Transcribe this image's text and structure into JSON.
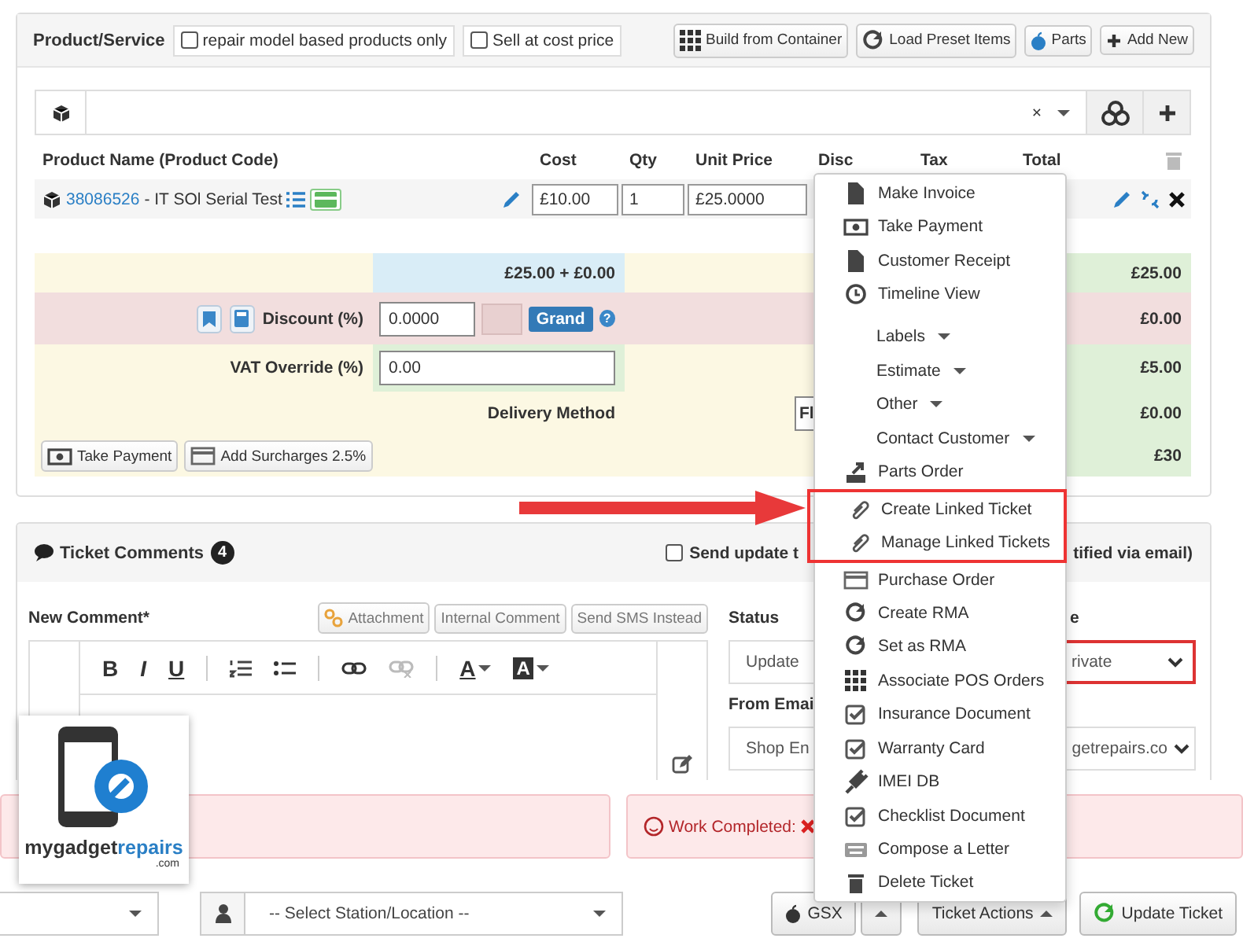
{
  "product_panel": {
    "title": "Product/Service",
    "options": [
      {
        "label": "repair model based products only",
        "checked": false
      },
      {
        "label": "Sell at cost price",
        "checked": false
      }
    ],
    "actions": [
      "Build from Container",
      "Load Preset Items",
      "Parts",
      "Add New"
    ]
  },
  "search": {
    "clear": "×"
  },
  "table": {
    "columns": [
      "Product Name (Product Code)",
      "Cost",
      "Qty",
      "Unit Price",
      "Disc",
      "Tax",
      "Total"
    ],
    "rows": [
      {
        "code": "38086526",
        "name": " - IT SOl Serial Test",
        "cost": "£10.00",
        "qty": "1",
        "unit_price": "£25.0000"
      }
    ]
  },
  "totals": {
    "subtotal": "£25.00 + £0.00",
    "discount_label": "Discount (%)",
    "discount": "0.0000",
    "discount_mode": "Grand",
    "help": "?",
    "vat_label": "VAT Override (%)",
    "vat": "0.00",
    "delivery_label": "Delivery Method",
    "delivery": "Fl",
    "buttons": [
      "Take Payment",
      "Add Surcharges 2.5%"
    ],
    "amounts": [
      "£25.00",
      "£0.00",
      "£5.00",
      "£0.00",
      "£30"
    ]
  },
  "comments": {
    "title": "Ticket Comments",
    "count": "4",
    "notify_start": "Send update t",
    "notify_end": "tified via email)",
    "notify_checked": false,
    "new_comment_label": "New Comment*",
    "buttons": [
      "Attachment",
      "Internal Comment",
      "Send SMS Instead"
    ],
    "toolbar": [
      "B",
      "I",
      "U",
      "A",
      "A"
    ],
    "status_label": "Status",
    "status": "Update",
    "type_label": "e",
    "type": "rivate",
    "from_label": "From Emai",
    "from_start": "Shop En",
    "from_end": "getrepairs.co"
  },
  "alert": {
    "text": "Work Completed:"
  },
  "footer": {
    "station_placeholder": "-- Select Station/Location --",
    "gsx": "GSX",
    "ticket_actions": "Ticket Actions",
    "update": "Update Ticket"
  },
  "menu": {
    "items": [
      {
        "label": "Make Invoice",
        "kind": "action",
        "highlighted": false
      },
      {
        "label": "Take Payment",
        "kind": "action",
        "highlighted": false
      },
      {
        "label": "Customer Receipt",
        "kind": "action",
        "highlighted": false
      },
      {
        "label": "Timeline View",
        "kind": "action",
        "highlighted": false
      },
      {
        "label": "Labels",
        "kind": "submenu",
        "highlighted": false
      },
      {
        "label": "Estimate",
        "kind": "submenu",
        "highlighted": false
      },
      {
        "label": "Other",
        "kind": "submenu",
        "highlighted": false
      },
      {
        "label": "Contact Customer",
        "kind": "submenu",
        "highlighted": false
      },
      {
        "label": "Parts Order",
        "kind": "action",
        "highlighted": false
      },
      {
        "label": "Create Linked Ticket",
        "kind": "action",
        "highlighted": true
      },
      {
        "label": "Manage Linked Tickets",
        "kind": "action",
        "highlighted": true
      },
      {
        "label": "Purchase Order",
        "kind": "action",
        "highlighted": false
      },
      {
        "label": "Create RMA",
        "kind": "action",
        "highlighted": false
      },
      {
        "label": "Set as RMA",
        "kind": "action",
        "highlighted": false
      },
      {
        "label": "Associate POS Orders",
        "kind": "action",
        "highlighted": false
      },
      {
        "label": "Insurance Document",
        "kind": "action",
        "highlighted": false
      },
      {
        "label": "Warranty Card",
        "kind": "action",
        "highlighted": false
      },
      {
        "label": "IMEI DB",
        "kind": "action",
        "highlighted": false
      },
      {
        "label": "Checklist Document",
        "kind": "action",
        "highlighted": false
      },
      {
        "label": "Compose a Letter",
        "kind": "action",
        "highlighted": false
      },
      {
        "label": "Delete Ticket",
        "kind": "action",
        "highlighted": false
      }
    ]
  },
  "logo": {
    "dark": "mygadget",
    "blue": "repairs",
    "suffix": ".com"
  }
}
